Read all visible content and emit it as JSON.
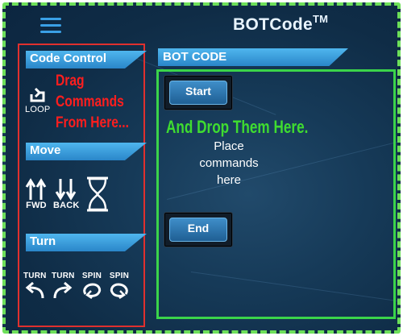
{
  "app": {
    "title": "BOTCode",
    "trademark": "TM"
  },
  "left": {
    "code_control": {
      "header": "Code Control",
      "loop_label": "LOOP"
    },
    "drag_hint": [
      "Drag",
      "Commands",
      "From Here..."
    ],
    "move": {
      "header": "Move",
      "fwd_label": "FWD",
      "back_label": "BACK"
    },
    "turn": {
      "header": "Turn",
      "items": [
        {
          "label": "TURN",
          "icon": "turn-left-icon"
        },
        {
          "label": "TURN",
          "icon": "turn-right-icon"
        },
        {
          "label": "SPIN",
          "icon": "spin-left-icon"
        },
        {
          "label": "SPIN",
          "icon": "spin-right-icon"
        }
      ]
    }
  },
  "editor": {
    "header": "BOT CODE",
    "start_label": "Start",
    "end_label": "End",
    "drop_hint": "And Drop Them Here.",
    "placeholder": [
      "Place",
      "commands",
      "here"
    ]
  },
  "colors": {
    "accent": "#3aa0e6",
    "left_panel_outline": "#e0302e",
    "drop_outline": "#3bd44a",
    "hint_red": "#ff1e1e",
    "hint_green": "#3fdc30"
  }
}
